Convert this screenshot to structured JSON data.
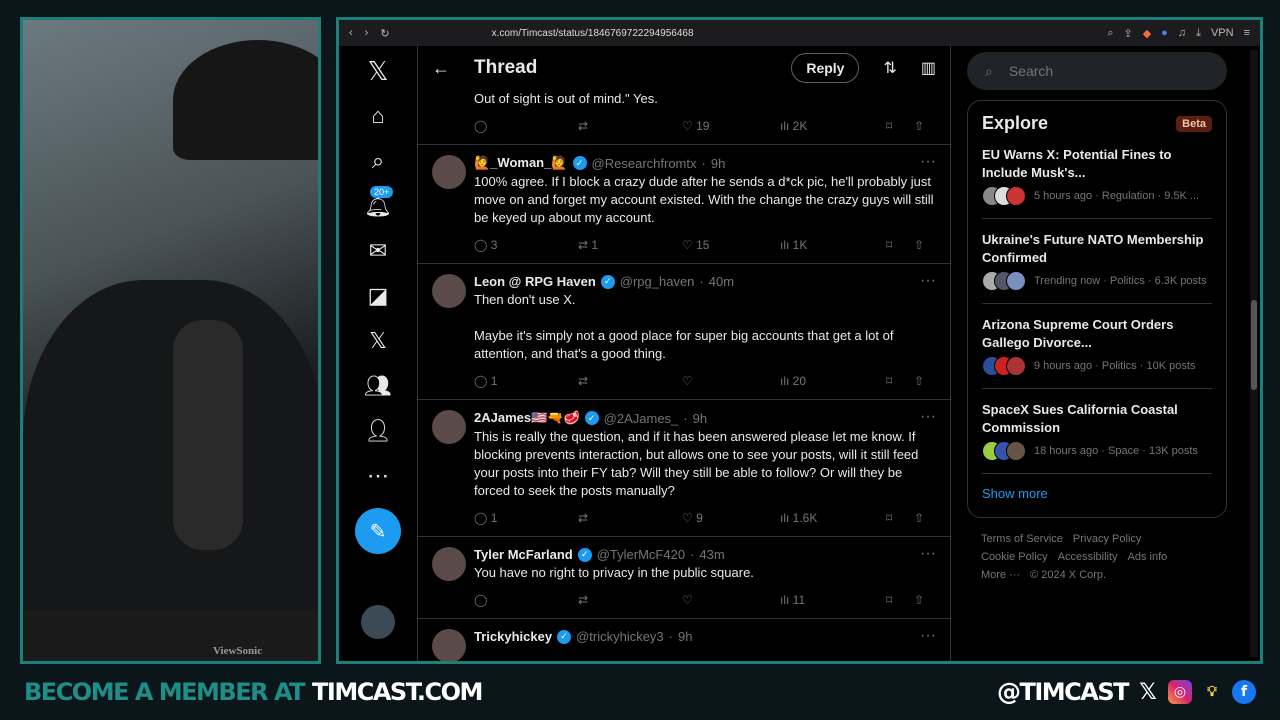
{
  "browser": {
    "url": "x.com/Timcast/status/1846769722294956468",
    "vpn": "VPN"
  },
  "nav": {
    "notif_badge": "20+"
  },
  "header": {
    "title": "Thread",
    "reply": "Reply"
  },
  "partial_top": {
    "text": "Out of sight is out of mind.\" Yes.",
    "likes": "19",
    "views": "2K"
  },
  "tweets": [
    {
      "name": "🙋_Woman_🙋",
      "handle": "@Researchfromtx",
      "time": "9h",
      "text": "100% agree. If I block a crazy dude after he sends a d*ck pic, he'll probably just move on and forget my account existed. With the change the crazy guys will still be keyed up about my account.",
      "replies": "3",
      "reposts": "1",
      "likes": "15",
      "views": "1K"
    },
    {
      "name": "Leon @ RPG Haven",
      "handle": "@rpg_haven",
      "time": "40m",
      "text": "Then don't use X.\n\nMaybe it's simply not a good place for super big accounts that get a lot of attention, and that's a good thing.",
      "replies": "1",
      "reposts": "",
      "likes": "",
      "views": "20"
    },
    {
      "name": "2AJames🇺🇸🔫🥩",
      "handle": "@2AJames_",
      "time": "9h",
      "text": "This is really the question, and if it has been answered please let me know. If blocking prevents interaction, but allows one to see your posts, will it still feed your posts into their FY tab? Will they still be able to follow? Or will they be forced to seek the posts manually?",
      "replies": "1",
      "reposts": "",
      "likes": "9",
      "views": "1.6K"
    },
    {
      "name": "Tyler McFarland",
      "handle": "@TylerMcF420",
      "time": "43m",
      "text": "You have no right to privacy in the public square.",
      "replies": "",
      "reposts": "",
      "likes": "",
      "views": "11"
    },
    {
      "name": "Trickyhickey",
      "handle": "@trickyhickey3",
      "time": "9h",
      "text": "",
      "replies": "",
      "reposts": "",
      "likes": "",
      "views": ""
    }
  ],
  "search": {
    "placeholder": "Search"
  },
  "explore": {
    "title": "Explore",
    "badge": "Beta",
    "items": [
      {
        "headline": "EU Warns X: Potential Fines to Include Musk's...",
        "meta": "5 hours ago · Regulation · 9.5K ..."
      },
      {
        "headline": "Ukraine's Future NATO Membership Confirmed",
        "meta": "Trending now · Politics · 6.3K posts"
      },
      {
        "headline": "Arizona Supreme Court Orders Gallego Divorce...",
        "meta": "9 hours ago · Politics · 10K posts"
      },
      {
        "headline": "SpaceX Sues California Coastal Commission",
        "meta": "18 hours ago · Space · 13K posts"
      }
    ],
    "show_more": "Show more"
  },
  "footer": [
    "Terms of Service",
    "Privacy Policy",
    "Cookie Policy",
    "Accessibility",
    "Ads info",
    "More ···",
    "© 2024 X Corp."
  ],
  "banner": {
    "left1": "BECOME A MEMBER AT",
    "left2": "TIMCAST.COM",
    "handle": "@TIMCAST"
  },
  "webcam": {
    "monitor_brand": "ViewSonic"
  },
  "colors": {
    "accent": "#1d9bf0",
    "frame": "#1d7f7a"
  }
}
